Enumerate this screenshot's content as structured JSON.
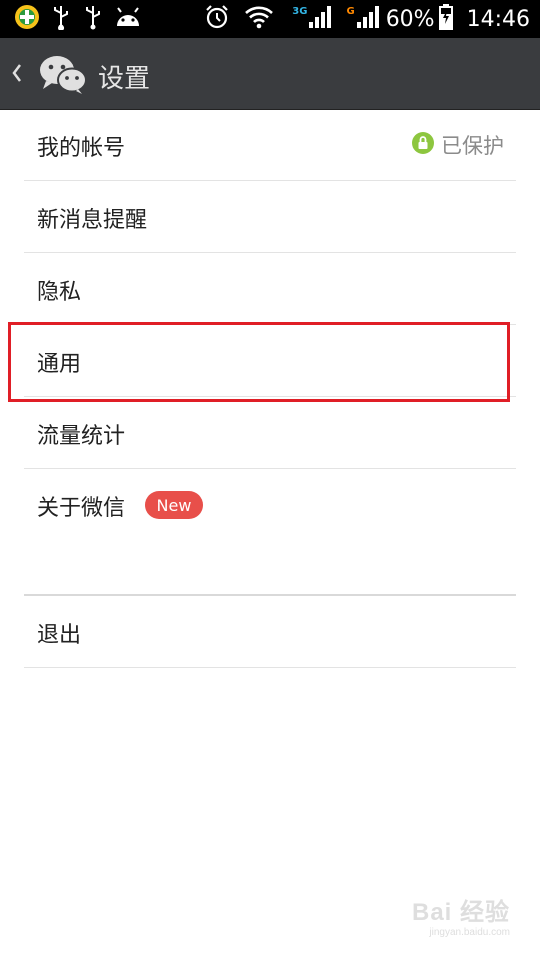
{
  "status_bar": {
    "battery_percent": "60%",
    "time": "14:46",
    "network_3g_label": "3G",
    "network_g_label": "G",
    "icons": [
      "app-badge-icon",
      "usb-icon",
      "usb-icon",
      "android-icon",
      "alarm-icon",
      "wifi-icon",
      "signal-3g-icon",
      "signal-g-icon",
      "battery-charging-icon"
    ]
  },
  "header": {
    "title": "设置",
    "back_icon": "chevron-left-icon",
    "logo_icon": "wechat-logo-icon"
  },
  "settings": {
    "account": {
      "label": "我的帐号",
      "status": "已保护",
      "status_icon": "lock-icon"
    },
    "notifications": {
      "label": "新消息提醒"
    },
    "privacy": {
      "label": "隐私"
    },
    "general": {
      "label": "通用"
    },
    "traffic": {
      "label": "流量统计"
    },
    "about": {
      "label": "关于微信",
      "badge": "New"
    },
    "logout": {
      "label": "退出"
    }
  },
  "watermark": {
    "main": "Bai 经验",
    "sub": "jingyan.baidu.com"
  },
  "colors": {
    "title_bar": "#3a3c3f",
    "badge": "#e84f4a",
    "lock_green": "#8dc63f",
    "highlight": "#e01e26",
    "divider": "#e3e3e3"
  }
}
